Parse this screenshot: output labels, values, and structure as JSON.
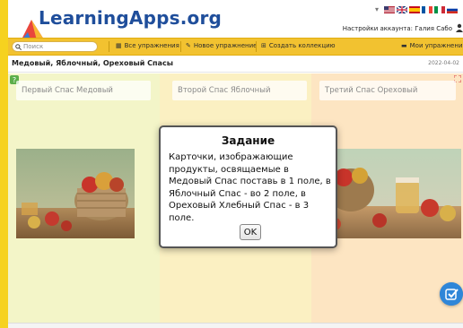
{
  "header": {
    "logo_text": "LearningApps.org",
    "account_text": "Настройки аккаунта: Галия Сабо",
    "language_flags": [
      "us-gb",
      "gb",
      "es",
      "fr",
      "it",
      "ru"
    ]
  },
  "nav": {
    "search_placeholder": "Поиск",
    "all_exercises": "Все упражнения",
    "new_exercise": "Новое упражнение",
    "create_collection": "Создать коллекцию",
    "my_exercises": "Мои упражнения"
  },
  "page": {
    "title": "Медовый, Яблочный, Ореховый Спасы",
    "date": "2022-04-02"
  },
  "exercise": {
    "fields": [
      {
        "label": "Первый Спас Медовый"
      },
      {
        "label": "Второй Спас Яблочный"
      },
      {
        "label": "Третий Спас Ореховый"
      }
    ],
    "field_colors": [
      "#f3f5c8",
      "#fbf0c2",
      "#fde5c2"
    ]
  },
  "modal": {
    "title": "Задание",
    "text": "Карточки, изображающие продукты, освящаемые в Медовый Спас поставь в 1 поле, в Яблочный Спас - во 2 поле, в Ореховый Хлебный Спас - в 3 поле.",
    "ok_label": "OK"
  },
  "icons": {
    "search": "search-icon",
    "check": "check-icon",
    "help": "help-icon",
    "fullscreen": "fullscreen-icon"
  },
  "colors": {
    "brand_yellow": "#f6d21f",
    "nav_bar": "#f2c230",
    "logo_blue": "#1f4e9b",
    "check_button": "#2f86d8"
  }
}
